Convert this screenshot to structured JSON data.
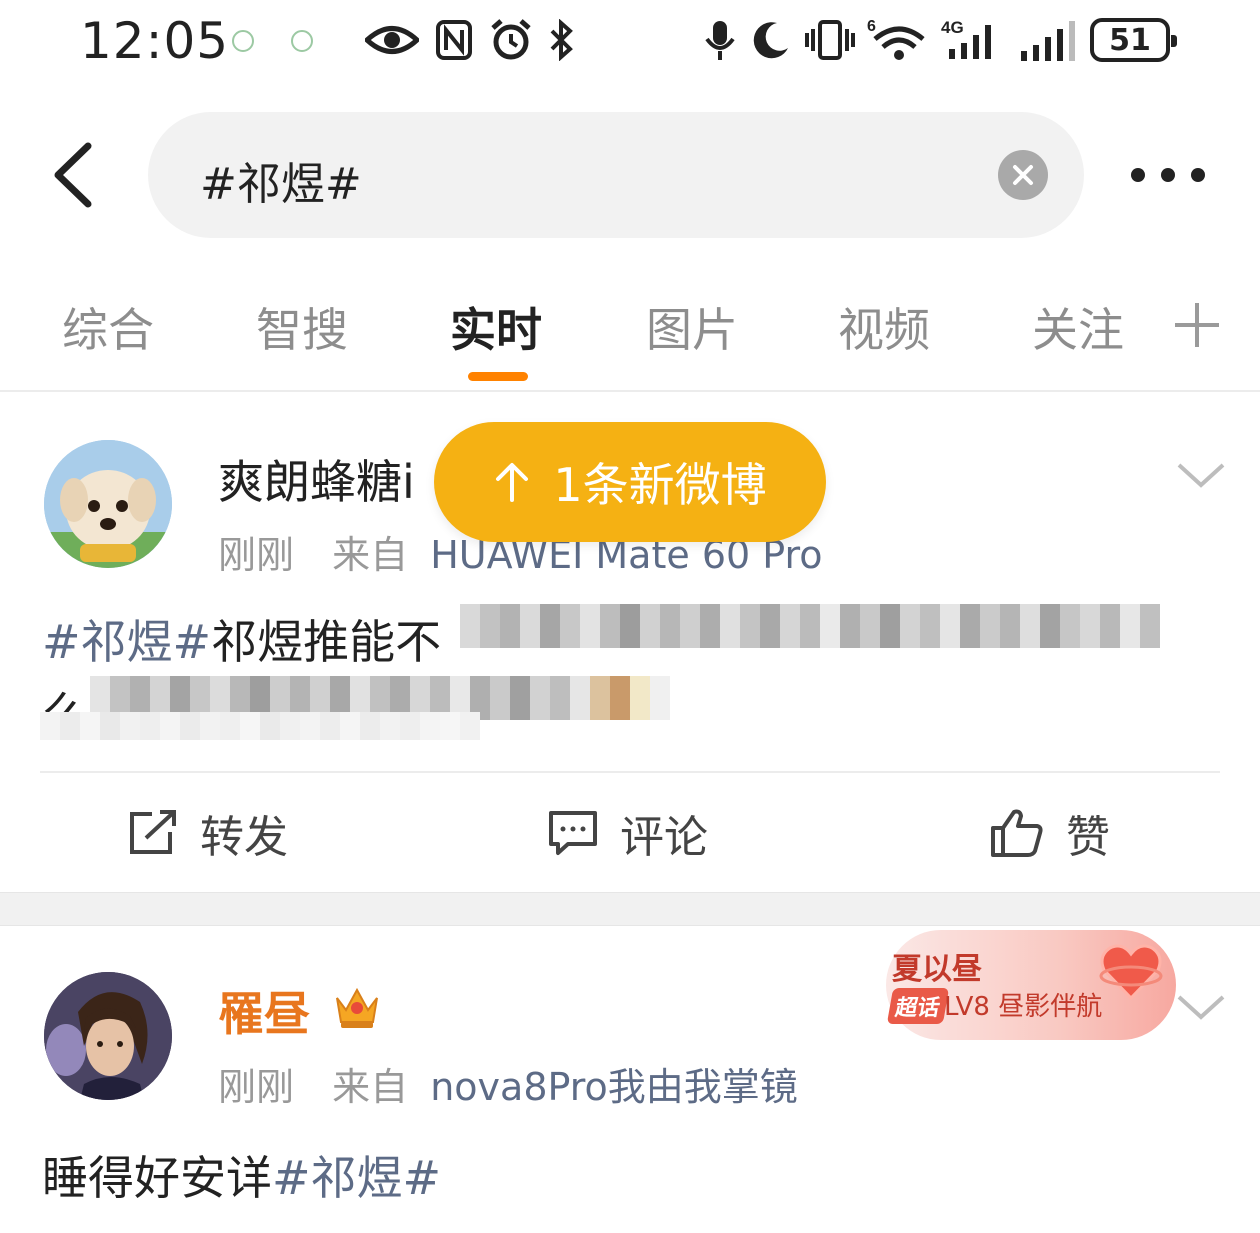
{
  "status_bar": {
    "time": "12:05",
    "network": "4G",
    "wifi_badge": "6",
    "battery": "51",
    "icons": [
      "eye-icon",
      "nfc-icon",
      "alarm-icon",
      "bluetooth-icon",
      "mic-icon",
      "moon-icon",
      "vibrate-icon",
      "wifi-icon",
      "signal-icon"
    ]
  },
  "search": {
    "query": "#祁煜#"
  },
  "tabs": [
    {
      "label": "综合"
    },
    {
      "label": "智搜"
    },
    {
      "label": "实时"
    },
    {
      "label": "图片"
    },
    {
      "label": "视频"
    },
    {
      "label": "关注"
    }
  ],
  "active_tab": "实时",
  "new_posts": {
    "label": "1条新微博"
  },
  "posts": [
    {
      "user": "爽朗蜂糖i",
      "time": "刚刚",
      "from_label": "来自",
      "source": "HUAWEI Mate 60 Pro",
      "text_hashtag": "#祁煜#",
      "text_visible": "祁煜推能不",
      "line2_start": "么",
      "actions": {
        "repost": "转发",
        "comment": "评论",
        "like": "赞"
      }
    },
    {
      "user": "罹昼",
      "time": "刚刚",
      "from_label": "来自",
      "source": "nova8Pro我由我掌镜",
      "text": "睡得好安详",
      "text_hashtag": "#祁煜#",
      "badge": {
        "title": "夏以昼",
        "tag": "超话",
        "level": "LV8 昼影伴航"
      }
    }
  ],
  "colors": {
    "accent": "#ff8200",
    "pill": "#f5b113",
    "link": "#5d6b86",
    "vip_name": "#e8761e"
  }
}
